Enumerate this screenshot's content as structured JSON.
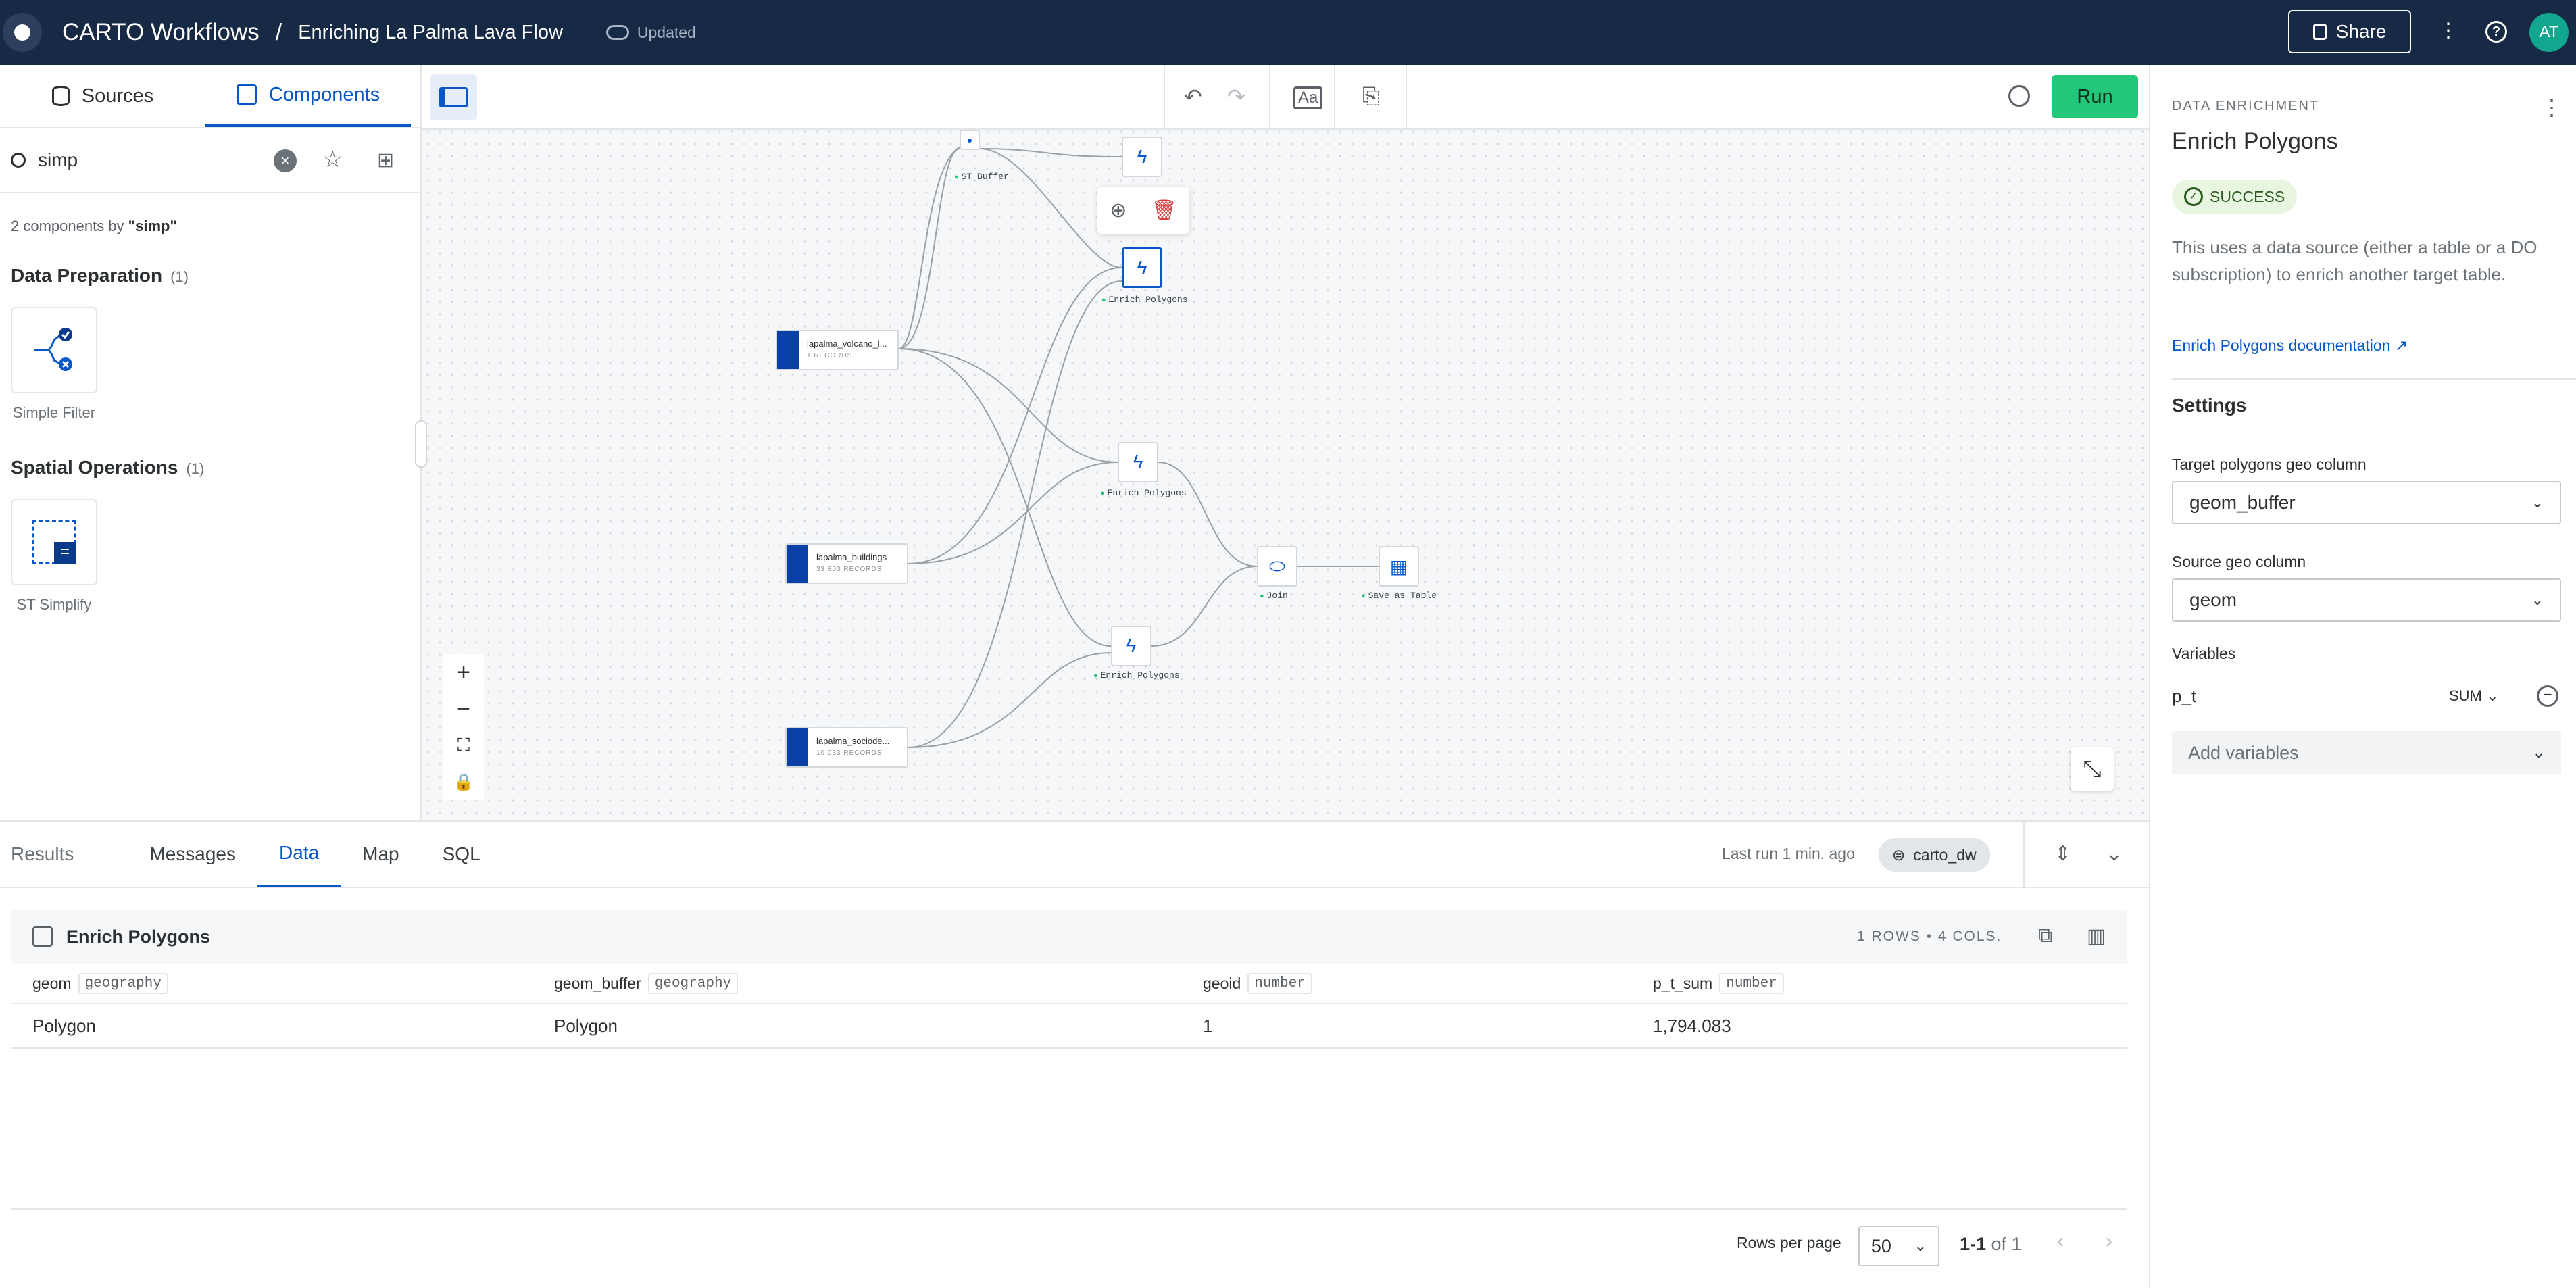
{
  "header": {
    "app_title": "CARTO Workflows",
    "separator": "/",
    "workflow_title": "Enriching La Palma Lava Flow",
    "save_status": "Updated",
    "share_label": "Share",
    "avatar_initials": "AT"
  },
  "left_panel": {
    "tabs": [
      {
        "label": "Sources",
        "active": false
      },
      {
        "label": "Components",
        "active": true
      }
    ],
    "search": {
      "value": "simp"
    },
    "result_count_prefix": "2 components by ",
    "result_count_query": "\"simp\"",
    "sections": [
      {
        "title": "Data Preparation",
        "count": "(1)",
        "items": [
          {
            "label": "Simple Filter",
            "icon": "simple-filter-icon"
          }
        ]
      },
      {
        "title": "Spatial Operations",
        "count": "(1)",
        "items": [
          {
            "label": "ST Simplify",
            "icon": "st-simplify-icon"
          }
        ]
      }
    ]
  },
  "canvas": {
    "nodes": {
      "buffer_label": "ST Buffer",
      "enrich_label_1": "Enrich Polygons",
      "enrich_label_2": "Enrich Polygons",
      "enrich_label_3": "Enrich Polygons",
      "join_label": "Join",
      "save_label": "Save as Table"
    },
    "sources": [
      {
        "name": "lapalma_volcano_l...",
        "records": "1 RECORDS"
      },
      {
        "name": "lapalma_buildings",
        "records": "33,803 RECORDS"
      },
      {
        "name": "lapalma_sociode...",
        "records": "10,033 RECORDS"
      }
    ],
    "run_label": "Run"
  },
  "right_panel": {
    "overline": "DATA ENRICHMENT",
    "title": "Enrich Polygons",
    "status": "SUCCESS",
    "description": "This uses a data source (either a table or a DO subscription) to enrich another target table.",
    "doc_link": "Enrich Polygons documentation",
    "settings_title": "Settings",
    "target_label": "Target polygons geo column",
    "target_value": "geom_buffer",
    "source_label": "Source geo column",
    "source_value": "geom",
    "variables_label": "Variables",
    "variable_name": "p_t",
    "variable_agg": "SUM",
    "add_variables": "Add variables"
  },
  "bottom_panel": {
    "tabs": [
      {
        "label": "Results",
        "active": false
      },
      {
        "label": "Messages",
        "active": false
      },
      {
        "label": "Data",
        "active": true
      },
      {
        "label": "Map",
        "active": false
      },
      {
        "label": "SQL",
        "active": false
      }
    ],
    "last_run": "Last run 1 min. ago",
    "connection": "carto_dw",
    "table_title": "Enrich Polygons",
    "table_meta": "1 ROWS • 4 COLS.",
    "columns": [
      {
        "name": "geom",
        "type": "geography"
      },
      {
        "name": "geom_buffer",
        "type": "geography"
      },
      {
        "name": "geoid",
        "type": "number"
      },
      {
        "name": "p_t_sum",
        "type": "number"
      }
    ],
    "rows": [
      [
        "Polygon",
        "Polygon",
        "1",
        "1,794.083"
      ]
    ],
    "rows_per_page_label": "Rows per page",
    "rows_per_page": "50",
    "range_bold": "1-1",
    "range_rest": " of 1"
  }
}
